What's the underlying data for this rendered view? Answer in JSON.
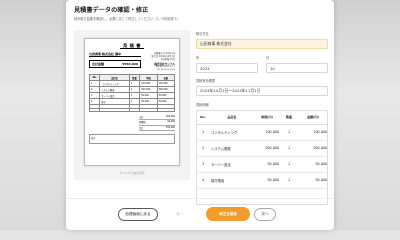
{
  "modal": {
    "title": "見積書データの確認・修正",
    "subtitle": "読み取り結果を確認し、必要に応じて修正してください（1／3件処理 2）"
  },
  "preview": {
    "doc_title": "見 積 書",
    "customer": "山田商事 株式会社 御中",
    "meta": [
      "見積番号 Q-2024-10",
      "発行日 2024年10月1日",
      "有効期限 30日"
    ],
    "issuer": "株式会社サンプル",
    "issuer_sub": [
      "東京都千代田区1-2-3",
      "TEL 03-0000-0000"
    ],
    "amount_label": "合計金額",
    "amount_value": "¥550,000",
    "table_headers": [
      "No.",
      "品目名",
      "数量",
      "単価",
      "金額"
    ],
    "table_rows": [
      [
        "1",
        "コンサルティング",
        "1",
        "100,000",
        "100,000"
      ],
      [
        "2",
        "システム開発",
        "1",
        "300,000",
        "300,000"
      ],
      [
        "3",
        "サーバー設定",
        "1",
        "50,000",
        "50,000"
      ],
      [
        "4",
        "保守",
        "1",
        "50,000",
        "50,000"
      ],
      [
        "",
        "",
        "",
        "",
        ""
      ],
      [
        "",
        "",
        "",
        "",
        ""
      ]
    ],
    "totals": [
      [
        "小計",
        "500,000"
      ],
      [
        "消費税",
        "50,000"
      ],
      [
        "合計",
        "550,000"
      ]
    ],
    "notes_label": "備考",
    "zoom_hint": "クリックで拡大表示"
  },
  "form": {
    "customer_label": "取引先名",
    "customer_value": "山田商事 株式会社",
    "year_label": "年",
    "year_value": "2024",
    "month_label": "月",
    "month_value": "10",
    "period_label": "見積有効期間",
    "period_value": "2024年10月1日〜2024年11月1日",
    "items_label": "見積明細",
    "items_headers": [
      "No.",
      "品目名",
      "単価(円)",
      "数量",
      "金額(円)"
    ],
    "items": [
      {
        "no": "1",
        "name": "コンサルティング",
        "price": "100,000",
        "qty": "1",
        "amount": "100,000"
      },
      {
        "no": "2",
        "name": "システム開発",
        "price": "300,000",
        "qty": "1",
        "amount": "300,000"
      },
      {
        "no": "3",
        "name": "サーバー設定",
        "price": "50,000",
        "qty": "1",
        "amount": "50,000"
      },
      {
        "no": "4",
        "name": "保守運用",
        "price": "50,000",
        "qty": "1",
        "amount": "50,000"
      }
    ]
  },
  "footer": {
    "back_label": "処理画面に戻る",
    "prev_label": "前へ",
    "save_label": "修正を保存",
    "next_label": "次へ"
  },
  "colors": {
    "accent": "#f39c2a",
    "highlight": "#fdf3df"
  }
}
